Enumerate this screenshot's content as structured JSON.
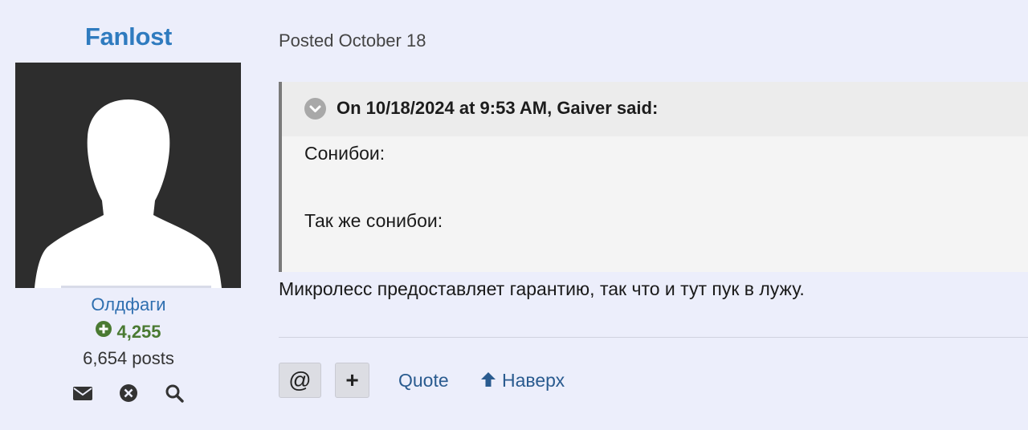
{
  "author": {
    "name": "Fanlost",
    "group": "Олдфаги",
    "reputation": "4,255",
    "reputation_icon": "plus-circle-icon",
    "posts": "6,654 posts",
    "actions": [
      "envelope-icon",
      "block-icon",
      "search-icon"
    ]
  },
  "post": {
    "meta": "Posted October 18",
    "quote": {
      "citation": "On 10/18/2024 at 9:53 AM, Gaiver said:",
      "toggle_icon": "chevron-down-icon",
      "lines": [
        "Сонибои:",
        "Так же сонибои:"
      ]
    },
    "body": "Микролесс предоставляет гарантию, так что и тут пук в лужу.",
    "controls": {
      "mention_label": "@",
      "plus_label": "+",
      "quote_label": "Quote",
      "top_label": "Наверх",
      "top_icon": "arrow-up-icon"
    }
  },
  "colors": {
    "page_bg": "#eceefb",
    "author_name": "#2f7bbf",
    "group": "#2f6fb0",
    "reputation": "#4a7a32",
    "link": "#2a5b8f",
    "quote_bg": "#f4f4f4",
    "quote_header_bg": "#ececec",
    "quote_border": "#7a7a7a",
    "avatar_bg": "#2d2d2d"
  }
}
